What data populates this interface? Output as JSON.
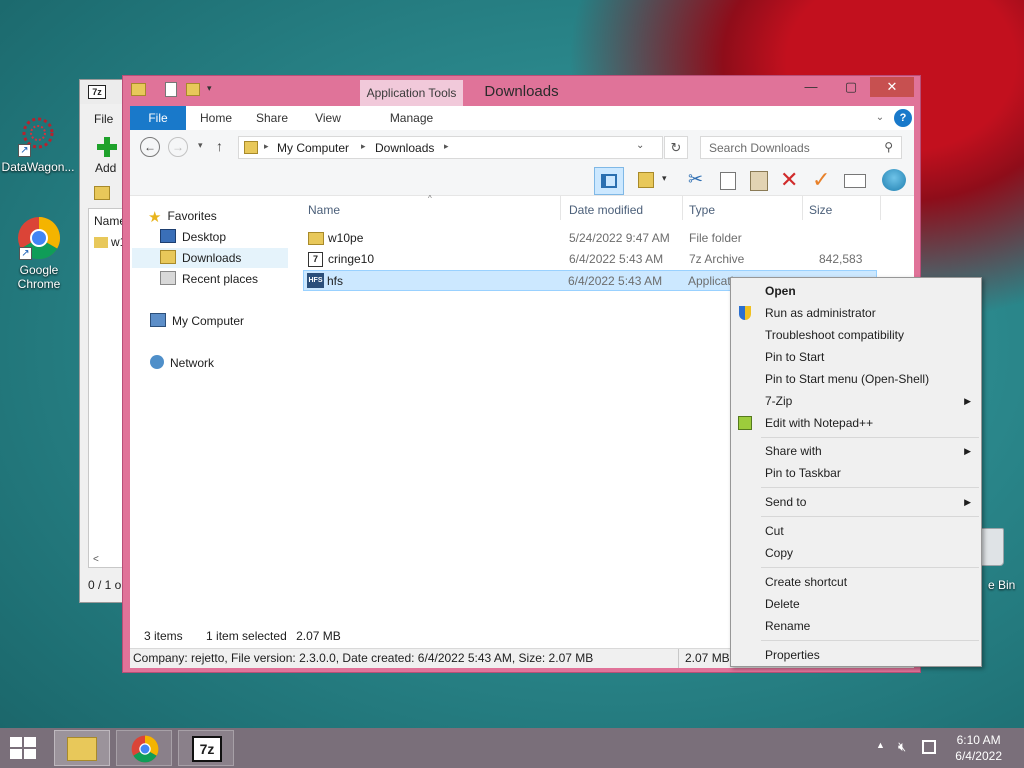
{
  "desktop": {
    "icons": [
      {
        "label": "DataWagon..."
      },
      {
        "label": "Google Chrome"
      }
    ],
    "recycle_bin_label": "e Bin"
  },
  "sevenzip_window": {
    "title_icon": "7z",
    "menu_file": "File",
    "add_label": "Add",
    "list_header": "Name",
    "list_item": "w1",
    "status": "0 / 1 o"
  },
  "explorer": {
    "title": "Downloads",
    "contextual_tab_group": "Application Tools",
    "tabs": [
      "File",
      "Home",
      "Share",
      "View",
      "Manage"
    ],
    "breadcrumb": [
      "My Computer",
      "Downloads"
    ],
    "search_placeholder": "Search Downloads",
    "nav": {
      "favorites": "Favorites",
      "desktop": "Desktop",
      "downloads": "Downloads",
      "recent": "Recent places",
      "computer": "My Computer",
      "network": "Network"
    },
    "columns": [
      "Name",
      "Date modified",
      "Type",
      "Size"
    ],
    "files": [
      {
        "name": "w10pe",
        "date": "5/24/2022 9:47 AM",
        "type": "File folder",
        "size": ""
      },
      {
        "name": "cringe10",
        "date": "6/4/2022 5:43 AM",
        "type": "7z Archive",
        "size": "842,583 KB"
      },
      {
        "name": "hfs",
        "date": "6/4/2022 5:43 AM",
        "type": "Applicati",
        "size": ""
      }
    ],
    "status": {
      "items": "3 items",
      "selected": "1 item selected",
      "selected_size": "2.07 MB"
    },
    "details": {
      "text": "Company: rejetto, File version: 2.3.0.0, Date created: 6/4/2022 5:43 AM, Size: 2.07 MB",
      "size": "2.07 MB"
    }
  },
  "context_menu": {
    "items": [
      "Open",
      "Run as administrator",
      "Troubleshoot compatibility",
      "Pin to Start",
      "Pin to Start menu (Open-Shell)",
      "7-Zip",
      "Edit with Notepad++",
      "Share with",
      "Pin to Taskbar",
      "Send to",
      "Cut",
      "Copy",
      "Create shortcut",
      "Delete",
      "Rename",
      "Properties"
    ]
  },
  "taskbar": {
    "time": "6:10 AM",
    "date": "6/4/2022",
    "pinned": [
      "File Explorer",
      "Google Chrome",
      "7-Zip"
    ]
  },
  "colors": {
    "window_frame": "#e07399",
    "file_tab": "#1979ca",
    "selection": "#cce8ff",
    "taskbar": "#7a6f7a",
    "close_button": "#c75050"
  }
}
